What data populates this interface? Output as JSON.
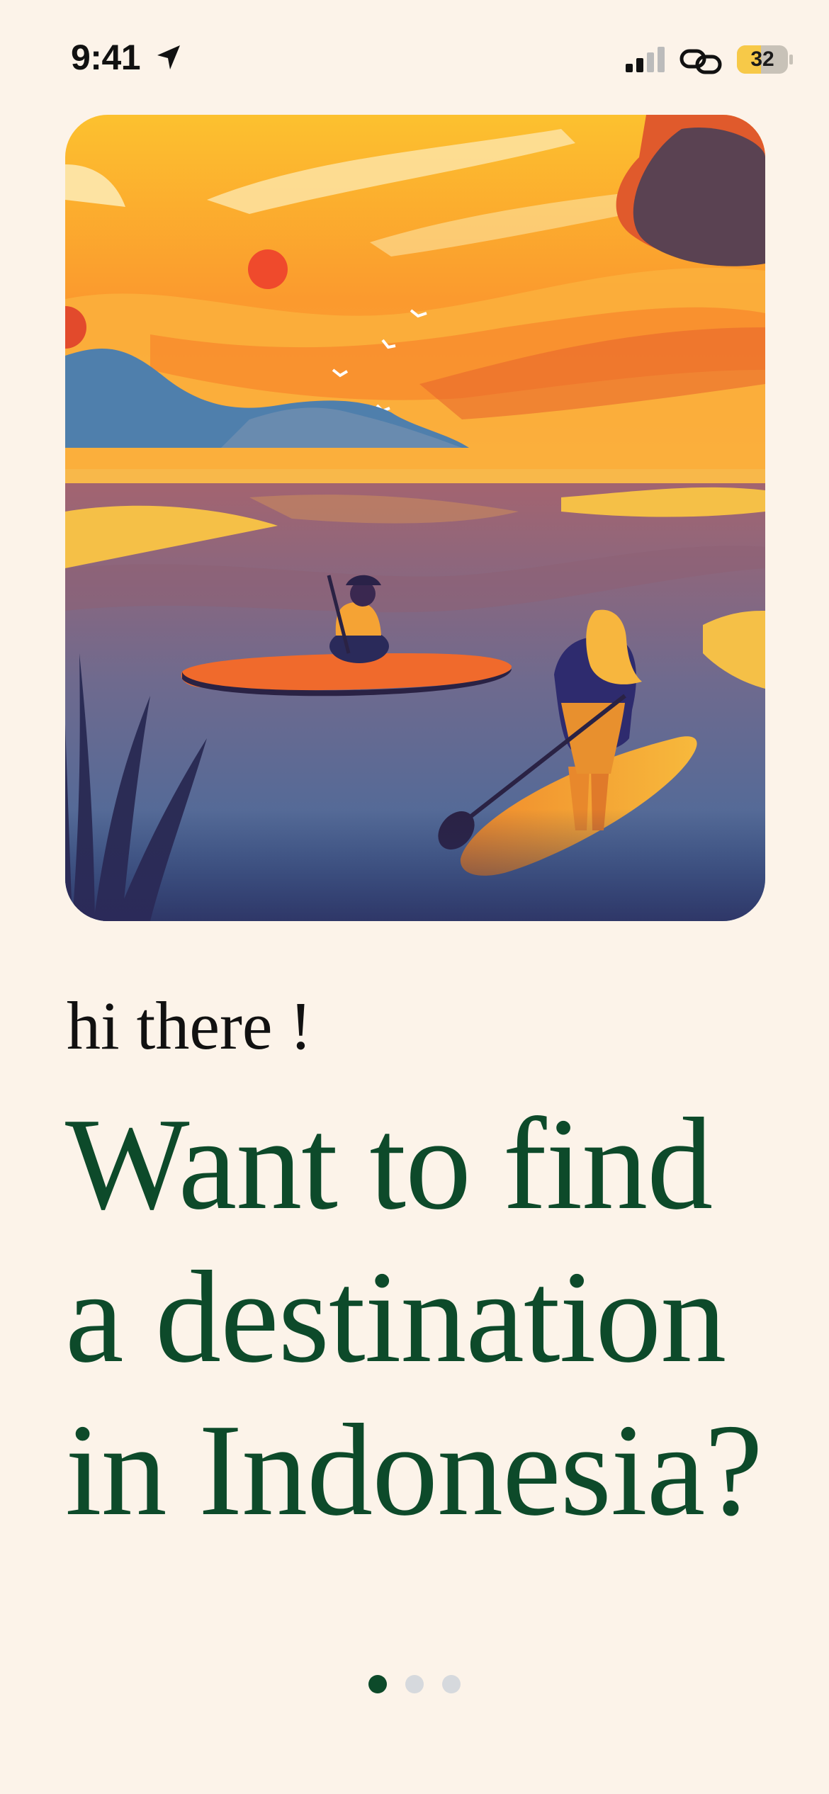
{
  "status_bar": {
    "time": "9:41",
    "battery": "32",
    "icons": [
      "location-arrow-icon",
      "signal-icon",
      "link-icon",
      "battery-icon"
    ]
  },
  "hero": {
    "icon": "paddleboard-sunset-illustration"
  },
  "onboarding": {
    "greeting": "hi there !",
    "headline_lines": [
      "Want to find",
      "a destination",
      "in Indonesia?"
    ]
  },
  "pager": {
    "count": 3,
    "active_index": 0
  },
  "colors": {
    "background": "#fcf3e9",
    "headline": "#0d4a2a",
    "dot_active": "#0d4a2a",
    "dot_inactive": "#d6d9dd",
    "battery_fill": "#f7c948"
  }
}
